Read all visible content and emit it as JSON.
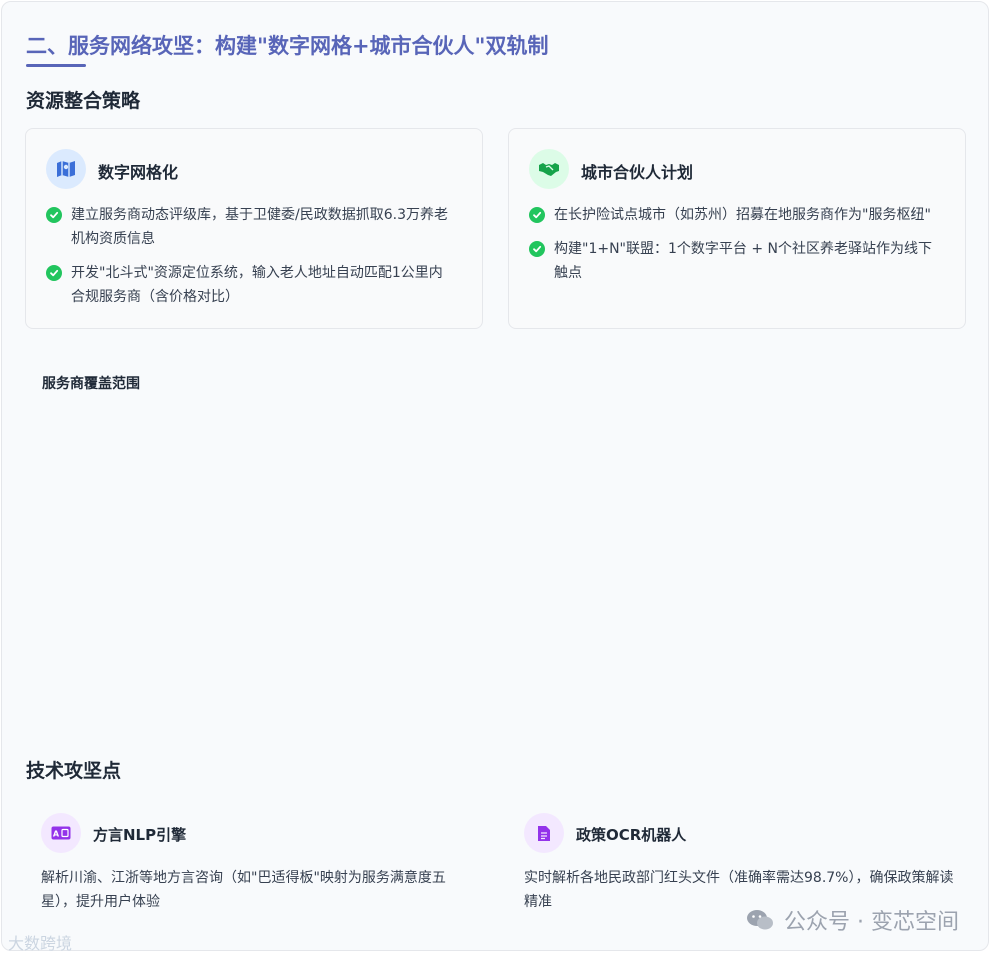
{
  "page_title": "二、服务网络攻坚：构建\"数字网格+城市合伙人\"双轨制",
  "resource_section": {
    "heading": "资源整合策略",
    "panels": [
      {
        "title": "数字网格化",
        "icon": "map-icon",
        "bullets": [
          "建立服务商动态评级库，基于卫健委/民政数据抓取6.3万养老机构资质信息",
          "开发\"北斗式\"资源定位系统，输入老人地址自动匹配1公里内合规服务商（含价格对比）"
        ]
      },
      {
        "title": "城市合伙人计划",
        "icon": "handshake-icon",
        "bullets": [
          "在长护险试点城市（如苏州）招募在地服务商作为\"服务枢纽\"",
          "构建\"1+N\"联盟：1个数字平台 + N个社区养老驿站作为线下触点"
        ]
      }
    ]
  },
  "coverage": {
    "label": "服务商覆盖范围"
  },
  "tech_section": {
    "heading": "技术攻坚点",
    "items": [
      {
        "title": "方言NLP引擎",
        "icon": "translate-icon",
        "desc": "解析川渝、江浙等地方言咨询（如\"巴适得板\"映射为服务满意度五星），提升用户体验"
      },
      {
        "title": "政策OCR机器人",
        "icon": "document-icon",
        "desc": "实时解析各地民政部门红头文件（准确率需达98.7%），确保政策解读精准"
      }
    ]
  },
  "watermark": {
    "text": "公众号 · 变芯空间",
    "left_text": "大数跨境"
  },
  "colors": {
    "title": "#5865b8",
    "check": "#22c55e",
    "map_icon_bg": "#dbeafe",
    "map_icon": "#3b6fd8",
    "handshake_bg": "#dcfce7",
    "handshake_icon": "#16a34a",
    "tech_icon_bg": "#f3e8ff",
    "tech_icon": "#9333ea"
  }
}
